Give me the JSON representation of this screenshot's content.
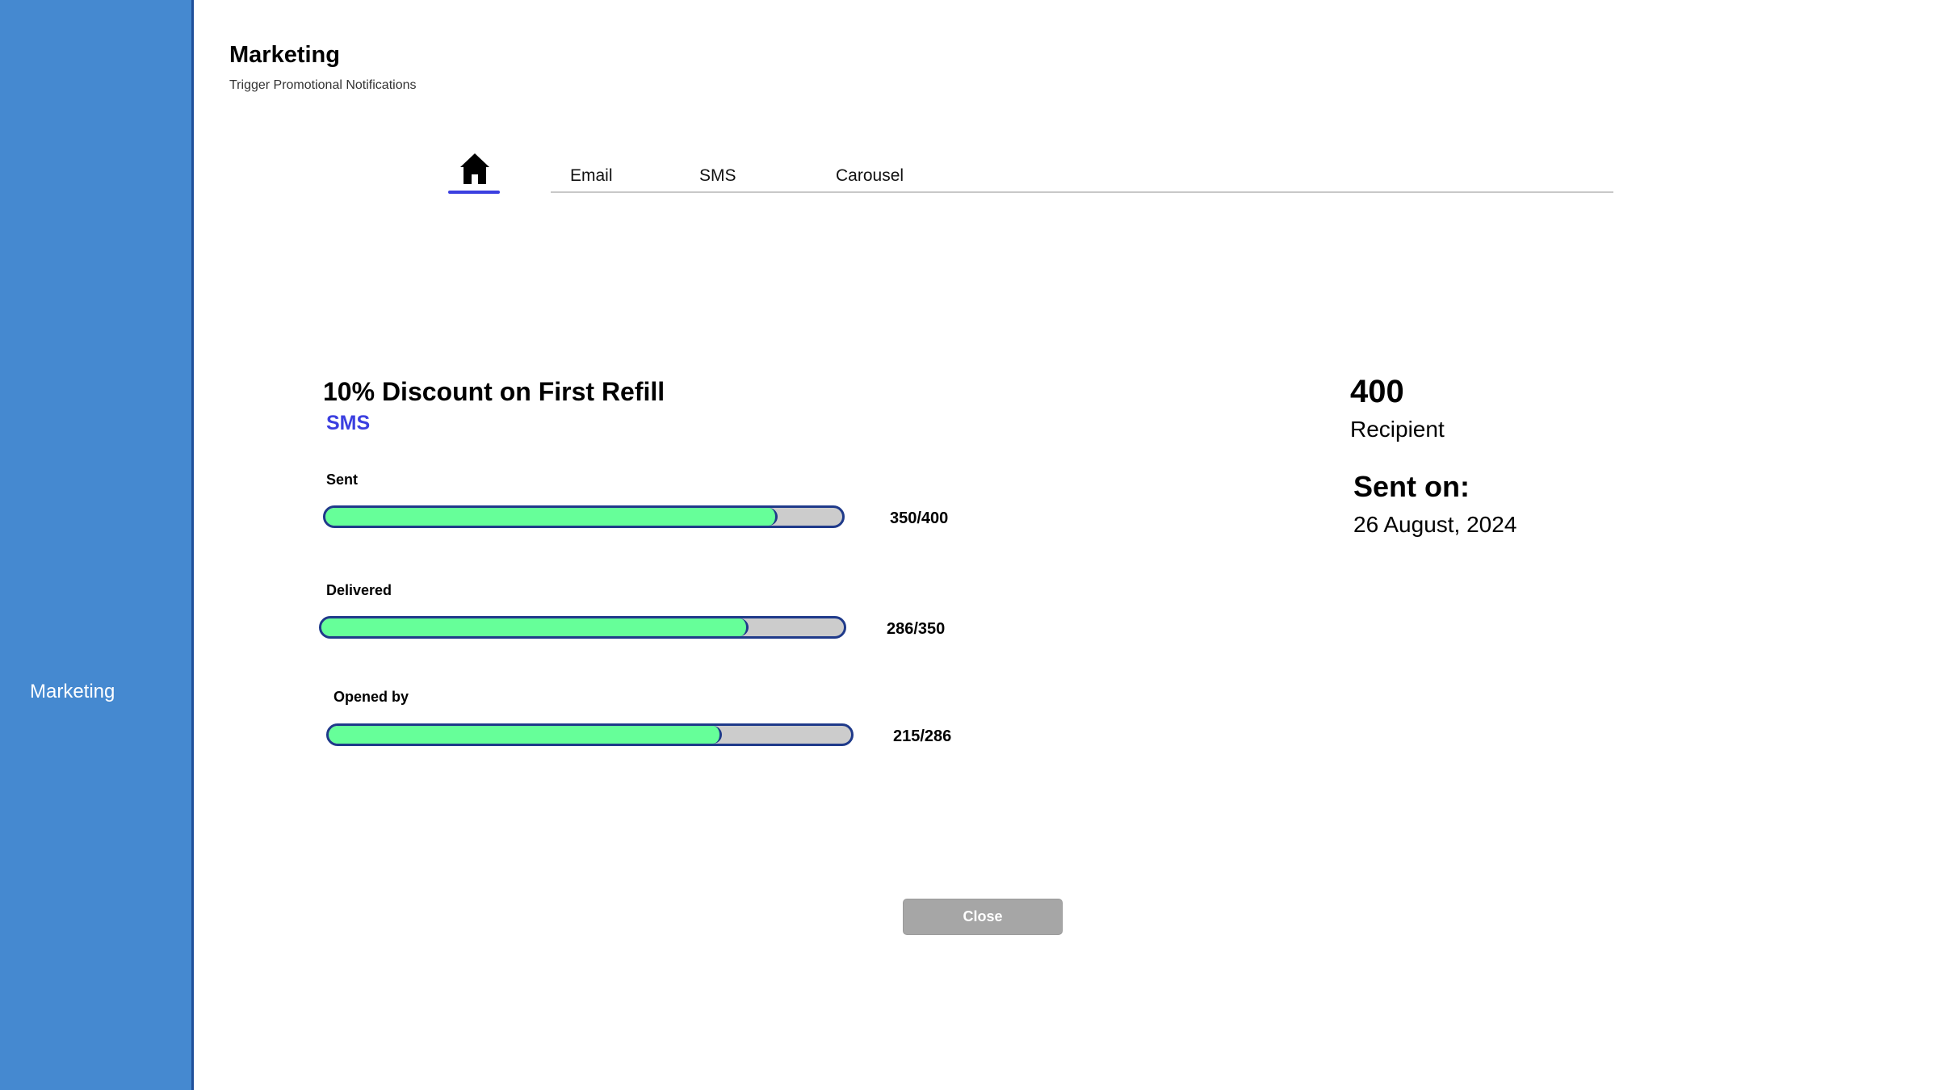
{
  "sidebar": {
    "items": [
      {
        "label": "Marketing"
      }
    ]
  },
  "header": {
    "title": "Marketing",
    "subtitle": "Trigger Promotional Notifications"
  },
  "tabs": [
    {
      "icon": "home-icon",
      "active": true
    },
    {
      "label": "Email"
    },
    {
      "label": "SMS"
    },
    {
      "label": "Carousel"
    }
  ],
  "campaign": {
    "title": "10% Discount on First Refill",
    "channel": "SMS",
    "metrics": [
      {
        "label": "Sent",
        "count": "350/400",
        "progress": 0.875
      },
      {
        "label": "Delivered",
        "count": "286/350",
        "progress": 0.817
      },
      {
        "label": "Opened by",
        "count": "215/286",
        "progress": 0.752
      }
    ]
  },
  "stats": {
    "recipients_count": "400",
    "recipients_label": "Recipient",
    "sent_on_label": "Sent on:",
    "sent_on_date": "26 August, 2024"
  },
  "actions": {
    "close_label": "Close"
  },
  "colors": {
    "sidebar": "#4589d0",
    "accent": "#3b3fe0",
    "progress_fill": "#66ff99",
    "progress_track": "#cccccc",
    "button": "#a6a6a6"
  }
}
